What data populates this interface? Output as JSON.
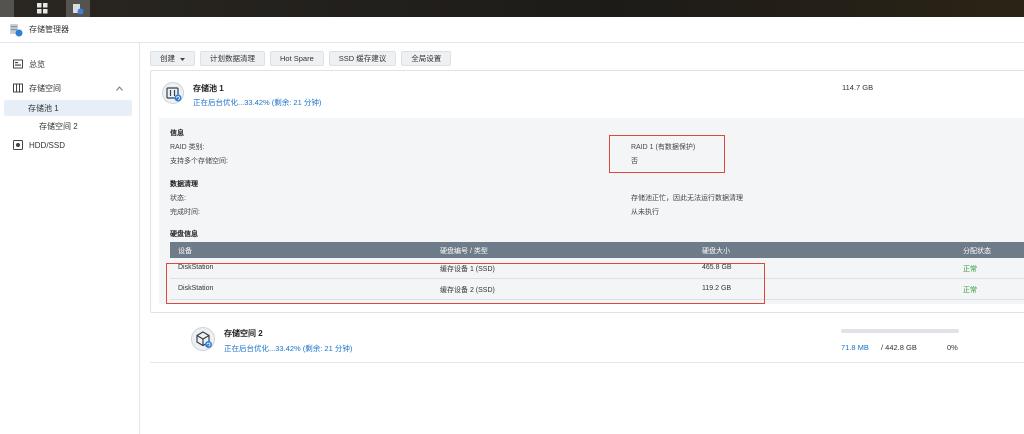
{
  "app": {
    "title": "存储管理器"
  },
  "sidebar": {
    "overview": "总览",
    "storage": "存储空间",
    "pool1": "存储池 1",
    "space2": "存储空间 2",
    "hdd": "HDD/SSD"
  },
  "toolbar": {
    "create": "创建",
    "schedule": "计划数据清理",
    "hotspare": "Hot Spare",
    "ssd": "SSD 缓存建议",
    "global": "全局设置"
  },
  "pool": {
    "name": "存储池 1",
    "status": "正在后台优化...33.42% (剩余: 21 分钟)",
    "size": "114.7 GB",
    "info_title": "信息",
    "raid_label": "RAID 类别:",
    "raid_value": "RAID 1 (有数据保护)",
    "multi_label": "支持多个存储空间:",
    "multi_value": "否",
    "scrub_title": "数据清理",
    "state_label": "状态:",
    "state_value": "存储池正忙，因此无法运行数据清理",
    "done_label": "完成时间:",
    "done_value": "从未执行",
    "disk_title": "硬盘信息",
    "table": {
      "headers": [
        "设备",
        "硬盘编号 / 类型",
        "硬盘大小",
        "分配状态"
      ],
      "rows": [
        [
          "DiskStation",
          "缓存设备 1 (SSD)",
          "465.8 GB",
          "正常"
        ],
        [
          "DiskStation",
          "缓存设备 2 (SSD)",
          "119.2 GB",
          "正常"
        ]
      ]
    }
  },
  "space2": {
    "name": "存储空间 2",
    "status": "正在后台优化...33.42% (剩余: 21 分钟)",
    "used": "71.8 MB",
    "total": "/ 442.8 GB",
    "percent": "0%",
    "usage_fraction": 0
  },
  "colors": {
    "accent": "#1a73c9",
    "ok": "#2e9a35",
    "highlight": "#e0473c",
    "table_header": "#6e7b88"
  }
}
